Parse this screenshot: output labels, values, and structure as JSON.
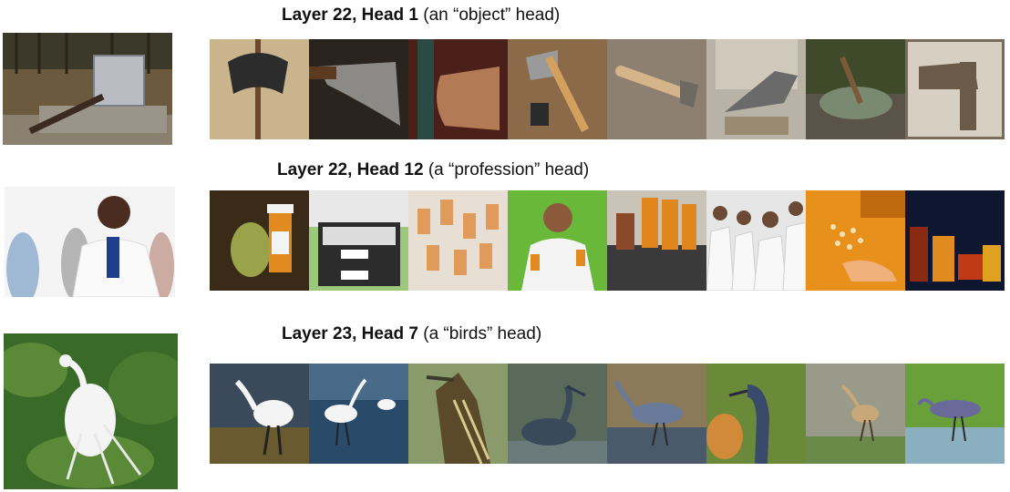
{
  "rows": [
    {
      "title_bold": "Layer 22, Head 1",
      "title_rest": " (an “object” head)",
      "query_subject": "hammer",
      "tiles": [
        "axe",
        "axe",
        "axe",
        "hatchet",
        "hatchet",
        "cleaver",
        "hatchet",
        "hatchet"
      ]
    },
    {
      "title_bold": "Layer 22, Head 12",
      "title_rest": " (a “profession” head)",
      "query_subject": "doctor",
      "tiles": [
        "pill-bottle",
        "papers",
        "pill-bottles",
        "doctor",
        "pill-bottles",
        "medical-team",
        "pills",
        "pill-bottles"
      ]
    },
    {
      "title_bold": "Layer 23, Head 7",
      "title_rest": " (a “birds” head)",
      "query_subject": "egret",
      "tiles": [
        "egret",
        "egret",
        "bittern",
        "heron",
        "heron",
        "heron",
        "heron",
        "heron"
      ]
    }
  ]
}
